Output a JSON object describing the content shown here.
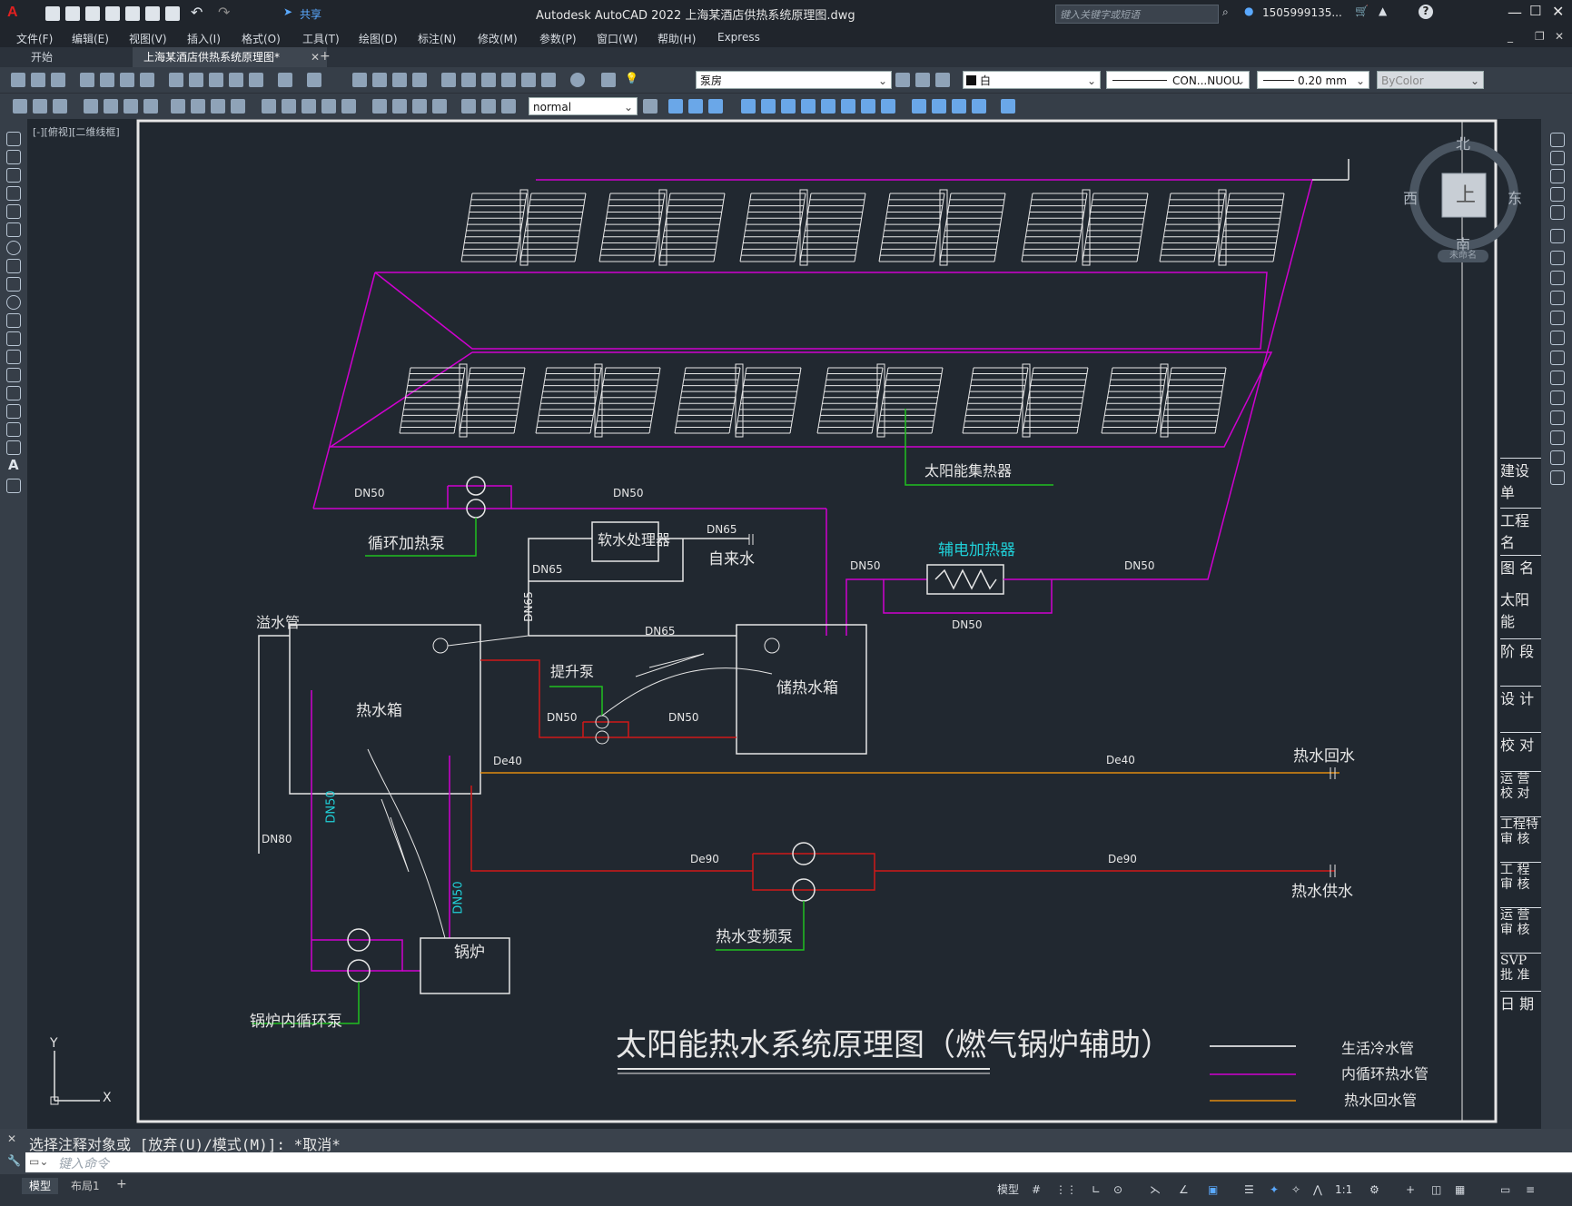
{
  "app": {
    "title": "Autodesk AutoCAD 2022    上海某酒店供热系统原理图.dwg",
    "share_label": "共享",
    "search_placeholder": "键入关键字或短语",
    "user": "1505999135...",
    "help": "?"
  },
  "menu": [
    "文件(F)",
    "编辑(E)",
    "视图(V)",
    "插入(I)",
    "格式(O)",
    "工具(T)",
    "绘图(D)",
    "标注(N)",
    "修改(M)",
    "参数(P)",
    "窗口(W)",
    "帮助(H)",
    "Express"
  ],
  "tabs": [
    {
      "label": "开始",
      "active": false
    },
    {
      "label": "上海某酒店供热系统原理图*",
      "active": true
    }
  ],
  "toolbar": {
    "layer": "泵房",
    "color": "白",
    "linetype": "CON...NUOU",
    "lineweight": "0.20 mm",
    "plotstyle": "ByColor",
    "textstyle": "normal"
  },
  "viewport_label": "[-][俯视][二维线框]",
  "viewcube": {
    "north": "北",
    "south": "南",
    "east": "东",
    "west": "西",
    "face": "上",
    "wcs": "未命名"
  },
  "drawing": {
    "title": "太阳能热水系统原理图（燃气锅炉辅助）",
    "labels": {
      "solar_collector": "太阳能集热器",
      "circ_pump": "循环加热泵",
      "softener": "软水处理器",
      "tap_water": "自来水",
      "aux_heater": "辅电加热器",
      "overflow": "溢水管",
      "hot_tank": "热水箱",
      "lift_pump": "提升泵",
      "storage_tank": "储热水箱",
      "hot_return": "热水回水",
      "hot_supply": "热水供水",
      "vf_pump": "热水变频泵",
      "boiler": "锅炉",
      "boiler_pump": "锅炉内循环泵"
    },
    "pipe_sizes": {
      "dn50": "DN50",
      "dn65": "DN65",
      "dn80": "DN80",
      "de40": "De40",
      "de90": "De90"
    },
    "legend": [
      {
        "label": "生活冷水管",
        "color": "#ffffff"
      },
      {
        "label": "内循环热水管",
        "color": "#d000d0"
      },
      {
        "label": "热水回水管",
        "color": "#e08a10"
      }
    ],
    "title_block": [
      "建设单",
      "工程名",
      "图 名",
      "太阳能",
      "阶 段",
      "设 计",
      "校 对",
      "运 营\n校 对",
      "工程特\n审 核",
      "工 程\n审 核",
      "运 营\n审 核",
      "SVP\n批 准",
      "日 期"
    ],
    "ucs": {
      "x": "X",
      "y": "Y"
    }
  },
  "command": {
    "history": "选择注释对象或 [放弃(U)/模式(M)]: *取消*",
    "placeholder": "键入命令"
  },
  "status": {
    "layout_tabs": [
      "模型",
      "布局1"
    ],
    "model": "模型",
    "scale": "1:1"
  },
  "colors": {
    "magenta": "#d000d0",
    "red": "#d01818",
    "orange": "#e08a10",
    "green": "#20c020",
    "cyan": "#20d0d8",
    "white": "#e6e6e6"
  }
}
